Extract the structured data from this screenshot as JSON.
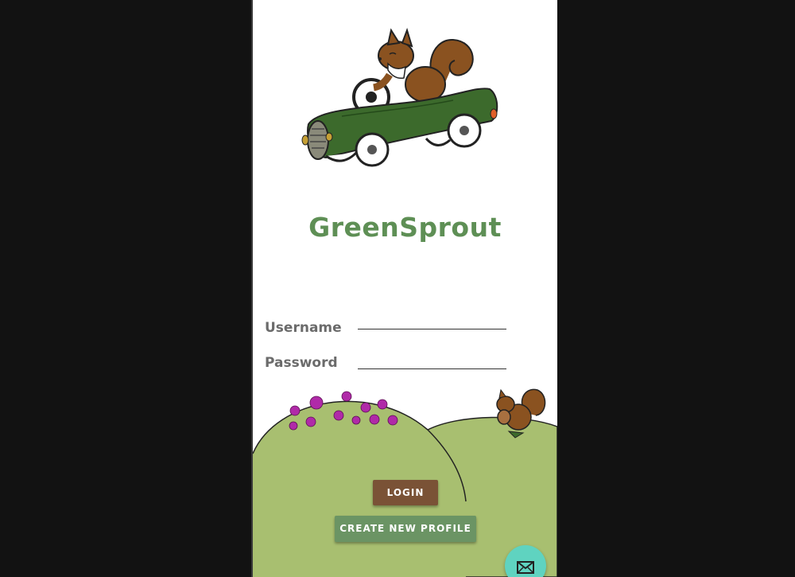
{
  "app": {
    "title": "GreenSprout"
  },
  "form": {
    "username_label": "Username",
    "password_label": "Password",
    "username_value": "",
    "password_value": ""
  },
  "buttons": {
    "login_label": "LOGIN",
    "create_label": "CREATE NEW PROFILE"
  },
  "icons": {
    "hero": "squirrel-driving-car-icon",
    "mascot": "squirrel-with-acorn-icon",
    "flowers": "flower-icon",
    "fab": "mail-icon"
  },
  "colors": {
    "title": "#5e8f55",
    "hill": "#a8bf70",
    "login_button": "#7a5236",
    "create_button": "#6b9464",
    "fab": "#5fd3c0",
    "flowers": "#b02aa8"
  }
}
